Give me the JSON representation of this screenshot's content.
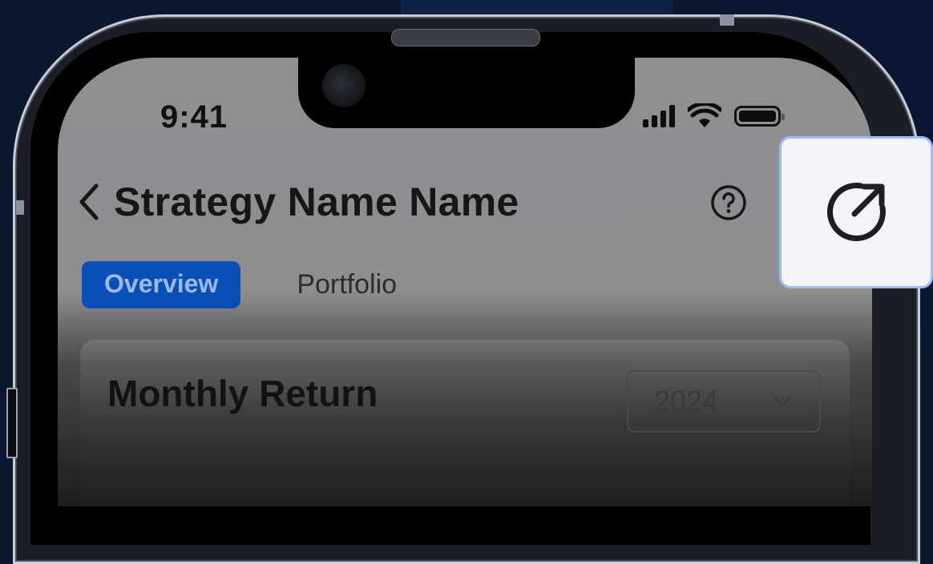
{
  "status_bar": {
    "time": "9:41",
    "icons": [
      "signal-icon",
      "wifi-icon",
      "battery-icon"
    ]
  },
  "header": {
    "back_icon": "chevron-left-icon",
    "title": "Strategy Name Name",
    "help_icon": "help-circle-icon"
  },
  "tabs": [
    {
      "label": "Overview",
      "active": true
    },
    {
      "label": "Portfolio",
      "active": false
    }
  ],
  "card": {
    "title": "Monthly Return",
    "year_select": {
      "value": "2024",
      "icon": "chevron-down-icon"
    }
  },
  "share_button": {
    "icon": "share-external-icon"
  },
  "colors": {
    "tab_active_bg": "#0b4fb6",
    "tab_active_text": "#9ab9ee",
    "share_border": "#9dbcf3",
    "background": "#0b1830"
  }
}
